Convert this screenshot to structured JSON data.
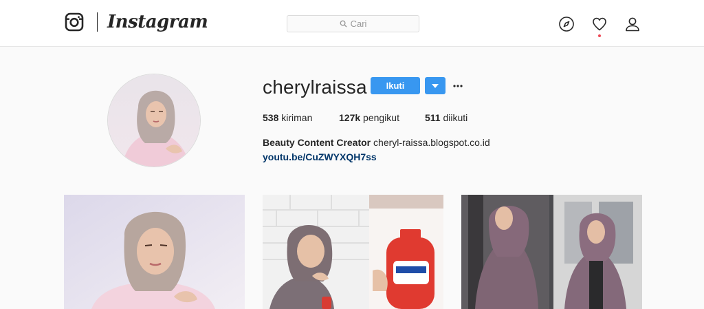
{
  "nav": {
    "brand": "Instagram",
    "search_placeholder": "Cari",
    "icons": [
      "instagram-camera-icon",
      "search-icon",
      "compass-icon",
      "heart-icon",
      "user-icon"
    ],
    "has_notification": true
  },
  "profile": {
    "username": "cherylraissa",
    "follow_label": "Ikuti",
    "stats": [
      {
        "value": "538",
        "label": "kiriman"
      },
      {
        "value": "127k",
        "label": "pengikut"
      },
      {
        "value": "511",
        "label": "diikuti"
      }
    ],
    "bio_name": "Beauty Content Creator",
    "bio_text": "cheryl-raissa.blogspot.co.id",
    "bio_link": "youtu.be/CuZWYXQH7ss"
  },
  "posts": [
    {
      "kind": "photo"
    },
    {
      "kind": "photo"
    },
    {
      "kind": "photo"
    }
  ],
  "colors": {
    "accent": "#3897f0",
    "link": "#003569",
    "notification": "#ed4956",
    "background": "#fafafa"
  }
}
